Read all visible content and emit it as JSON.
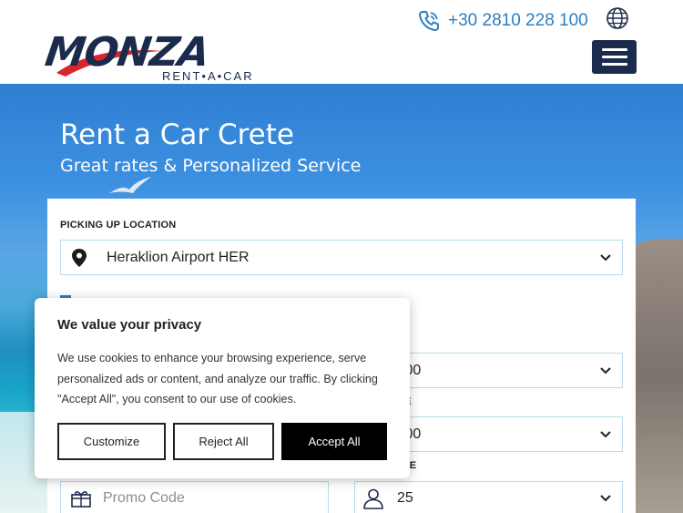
{
  "header": {
    "logo_text": "MONZA",
    "logo_tagline": "RENT•A•CAR",
    "phone": "+30 2810 228 100",
    "icons": {
      "phone": "phone-icon",
      "globe": "globe-icon",
      "menu": "hamburger-menu-icon"
    },
    "colors": {
      "brand_navy": "#1b2b4d",
      "accent_blue": "#2b7fc3",
      "swoosh_red": "#d8262f"
    }
  },
  "hero": {
    "title": "Rent a Car Crete",
    "subtitle": "Great rates & Personalized Service"
  },
  "booking": {
    "pickup_label": "PICKING UP LOCATION",
    "pickup_value": "Heraklion Airport HER",
    "pickup_time_label_partial": "E",
    "pickup_time_partial": ":00",
    "return_time_label_partial": "IE",
    "return_time_partial": ":00",
    "age_label_partial": "GE",
    "promo_placeholder": "Promo Code",
    "age_value": "25"
  },
  "cookie": {
    "title": "We value your privacy",
    "text": "We use cookies to enhance your browsing experience, serve personalized ads or content, and analyze our traffic. By clicking \"Accept All\", you consent to our use of cookies.",
    "customize": "Customize",
    "reject": "Reject All",
    "accept": "Accept All"
  }
}
